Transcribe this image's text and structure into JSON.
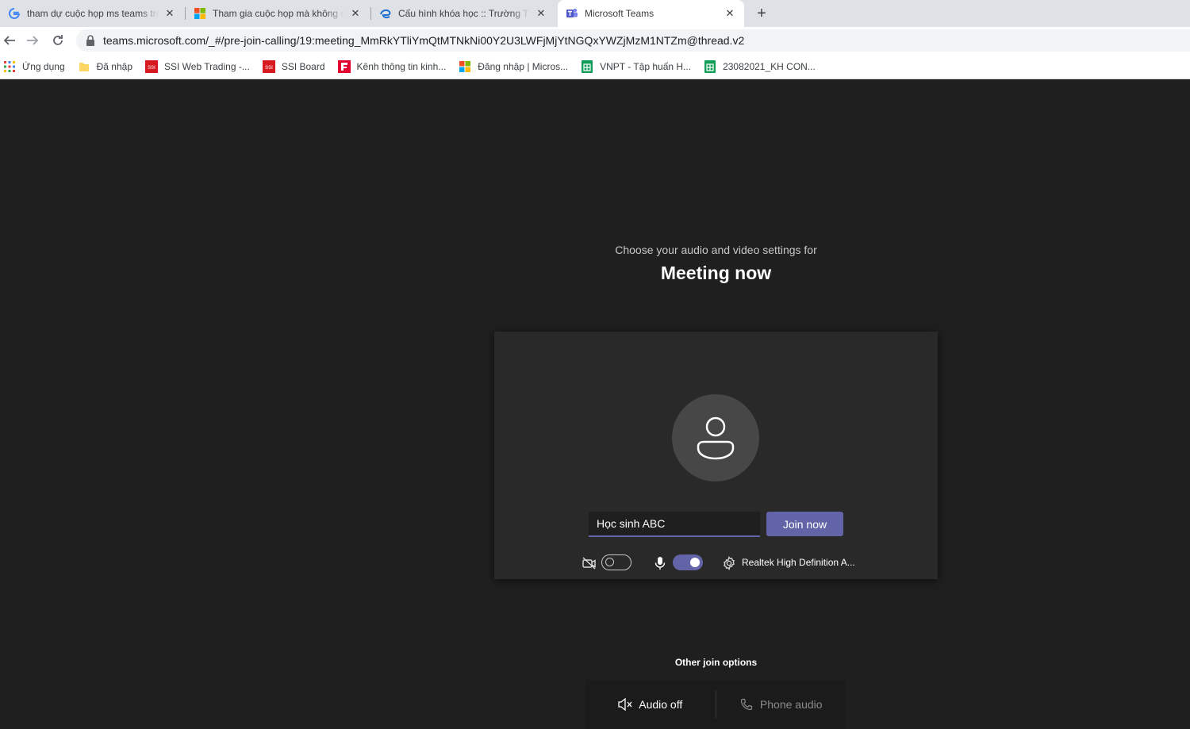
{
  "browser": {
    "tabs": [
      {
        "title": "tham dự cuộc họp ms teams trên",
        "favicon": "google-icon",
        "active": false
      },
      {
        "title": "Tham gia cuộc họp mà không cần",
        "favicon": "microsoft-icon",
        "active": false
      },
      {
        "title": "Cấu hình khóa học :: Trường THCS",
        "favicon": "edge-icon",
        "active": false
      },
      {
        "title": "Microsoft Teams",
        "favicon": "teams-icon",
        "active": true
      }
    ],
    "tab_close_glyph": "✕",
    "new_tab_glyph": "+",
    "url": "teams.microsoft.com/_#/pre-join-calling/19:meeting_MmRkYTliYmQtMTNkNi00Y2U3LWFjMjYtNGQxYWZjMzM1NTZm@thread.v2",
    "bookmarks": [
      {
        "label": "Ứng dụng",
        "icon": "apps-grid-icon"
      },
      {
        "label": "Đã nhập",
        "icon": "folder-icon"
      },
      {
        "label": "SSI Web Trading -...",
        "icon": "ssi-icon"
      },
      {
        "label": "SSI Board",
        "icon": "ssi-icon"
      },
      {
        "label": "Kênh thông tin kinh...",
        "icon": "flag-red-icon"
      },
      {
        "label": "Đăng nhập | Micros...",
        "icon": "microsoft-icon"
      },
      {
        "label": "VNPT - Tập huấn H...",
        "icon": "sheets-icon"
      },
      {
        "label": "23082021_KH CON...",
        "icon": "sheets-icon"
      }
    ]
  },
  "prejoin": {
    "subtitle": "Choose your audio and video settings for",
    "meeting_title": "Meeting now",
    "name_value": "Học sinh ABC",
    "join_label": "Join now",
    "camera_on": false,
    "mic_on": true,
    "audio_device": "Realtek High Definition A...",
    "other_options_title": "Other join options",
    "audio_off_label": "Audio off",
    "phone_audio_label": "Phone audio",
    "accent_color": "#6264a7"
  }
}
